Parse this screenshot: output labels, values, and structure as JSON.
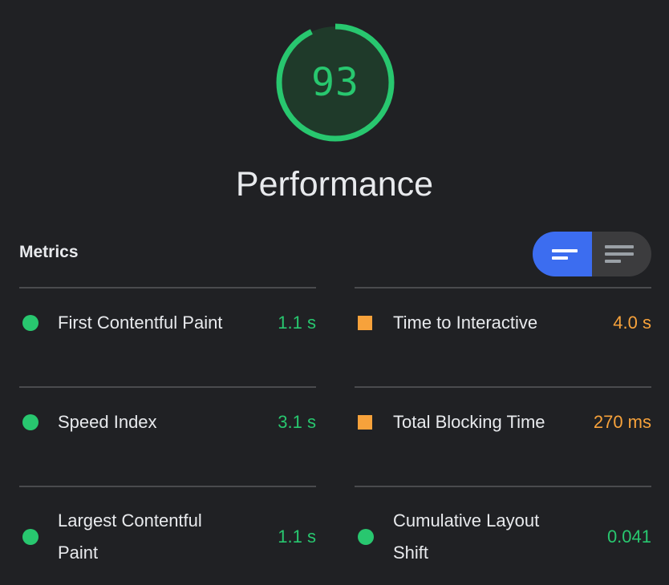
{
  "colors": {
    "pass": "#28c76f",
    "average": "#f7a23b",
    "accent": "#3c6df0",
    "gauge_fill": "#1f3a2a"
  },
  "gauge": {
    "score": "93",
    "score_value": 93,
    "category": "Performance"
  },
  "metrics": {
    "heading": "Metrics",
    "toggle": {
      "compact_view_icon": "lines-short-icon",
      "expanded_view_icon": "lines-long-icon"
    },
    "items": [
      {
        "label": "First Contentful Paint",
        "value": "1.1 s",
        "status": "pass"
      },
      {
        "label": "Time to Interactive",
        "value": "4.0 s",
        "status": "average"
      },
      {
        "label": "Speed Index",
        "value": "3.1 s",
        "status": "pass"
      },
      {
        "label": "Total Blocking Time",
        "value": "270 ms",
        "status": "average"
      },
      {
        "label": "Largest Contentful Paint",
        "value": "1.1 s",
        "status": "pass"
      },
      {
        "label": "Cumulative Layout Shift",
        "value": "0.041",
        "status": "pass"
      }
    ]
  }
}
